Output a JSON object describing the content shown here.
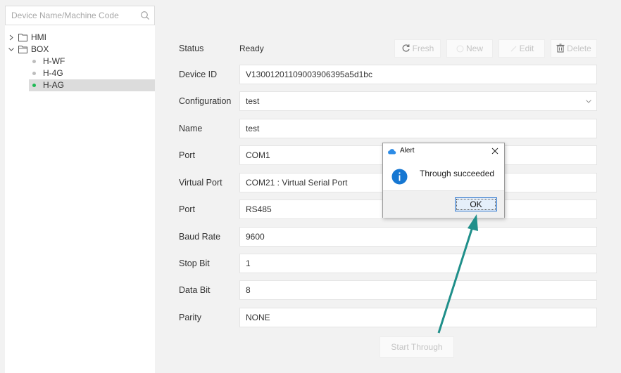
{
  "sidebar": {
    "search_placeholder": "Device Name/Machine Code",
    "tree": {
      "hmi": "HMI",
      "box": "BOX",
      "children": [
        "H-WF",
        "H-4G",
        "H-AG"
      ]
    }
  },
  "toolbar": {
    "fresh": "Fresh",
    "new": "New",
    "edit": "Edit",
    "delete": "Delete"
  },
  "form": {
    "status": {
      "label": "Status",
      "value": "Ready"
    },
    "device_id": {
      "label": "Device ID",
      "value": "V1300120110900390​6395a5d1bc"
    },
    "configuration": {
      "label": "Configuration",
      "value": "test"
    },
    "name": {
      "label": "Name",
      "value": "test"
    },
    "port": {
      "label": "Port",
      "value": "COM1"
    },
    "virtual_port": {
      "label": "Virtual Port",
      "value": "COM21 : Virtual Serial Port"
    },
    "port2": {
      "label": "Port",
      "value": "RS485"
    },
    "baud_rate": {
      "label": "Baud Rate",
      "value": "9600"
    },
    "stop_bit": {
      "label": "Stop Bit",
      "value": "1"
    },
    "data_bit": {
      "label": "Data Bit",
      "value": "8"
    },
    "parity": {
      "label": "Parity",
      "value": "NONE"
    }
  },
  "start_button": "Start Through",
  "alert": {
    "title": "Alert",
    "message": "Through succeeded",
    "ok": "OK"
  },
  "colors": {
    "selected_dot": "#1db954",
    "info_icon": "#1677d2",
    "annotation_arrow": "#1f8f8a"
  }
}
